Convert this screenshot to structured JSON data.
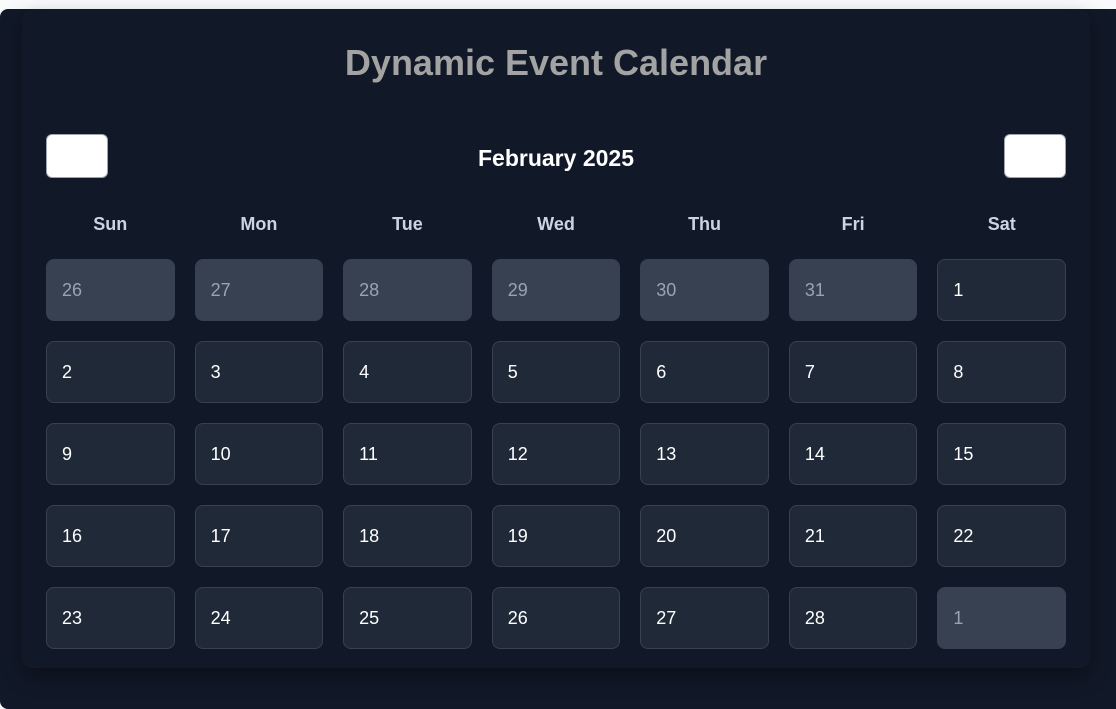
{
  "title": "Dynamic Event Calendar",
  "header": {
    "month_label": "February 2025",
    "prev_label": "",
    "next_label": ""
  },
  "weekdays": [
    "Sun",
    "Mon",
    "Tue",
    "Wed",
    "Thu",
    "Fri",
    "Sat"
  ],
  "days": [
    {
      "d": "26",
      "other": true
    },
    {
      "d": "27",
      "other": true
    },
    {
      "d": "28",
      "other": true
    },
    {
      "d": "29",
      "other": true
    },
    {
      "d": "30",
      "other": true
    },
    {
      "d": "31",
      "other": true
    },
    {
      "d": "1",
      "other": false
    },
    {
      "d": "2",
      "other": false
    },
    {
      "d": "3",
      "other": false
    },
    {
      "d": "4",
      "other": false
    },
    {
      "d": "5",
      "other": false
    },
    {
      "d": "6",
      "other": false
    },
    {
      "d": "7",
      "other": false
    },
    {
      "d": "8",
      "other": false
    },
    {
      "d": "9",
      "other": false
    },
    {
      "d": "10",
      "other": false
    },
    {
      "d": "11",
      "other": false
    },
    {
      "d": "12",
      "other": false
    },
    {
      "d": "13",
      "other": false
    },
    {
      "d": "14",
      "other": false
    },
    {
      "d": "15",
      "other": false
    },
    {
      "d": "16",
      "other": false
    },
    {
      "d": "17",
      "other": false
    },
    {
      "d": "18",
      "other": false
    },
    {
      "d": "19",
      "other": false
    },
    {
      "d": "20",
      "other": false
    },
    {
      "d": "21",
      "other": false
    },
    {
      "d": "22",
      "other": false
    },
    {
      "d": "23",
      "other": false
    },
    {
      "d": "24",
      "other": false
    },
    {
      "d": "25",
      "other": false
    },
    {
      "d": "26",
      "other": false
    },
    {
      "d": "27",
      "other": false
    },
    {
      "d": "28",
      "other": false
    },
    {
      "d": "1",
      "other": true
    }
  ],
  "colors": {
    "background": "#111827",
    "cell": "#1f2937",
    "other_month_cell": "#374151",
    "title": "#a3a3a3"
  }
}
